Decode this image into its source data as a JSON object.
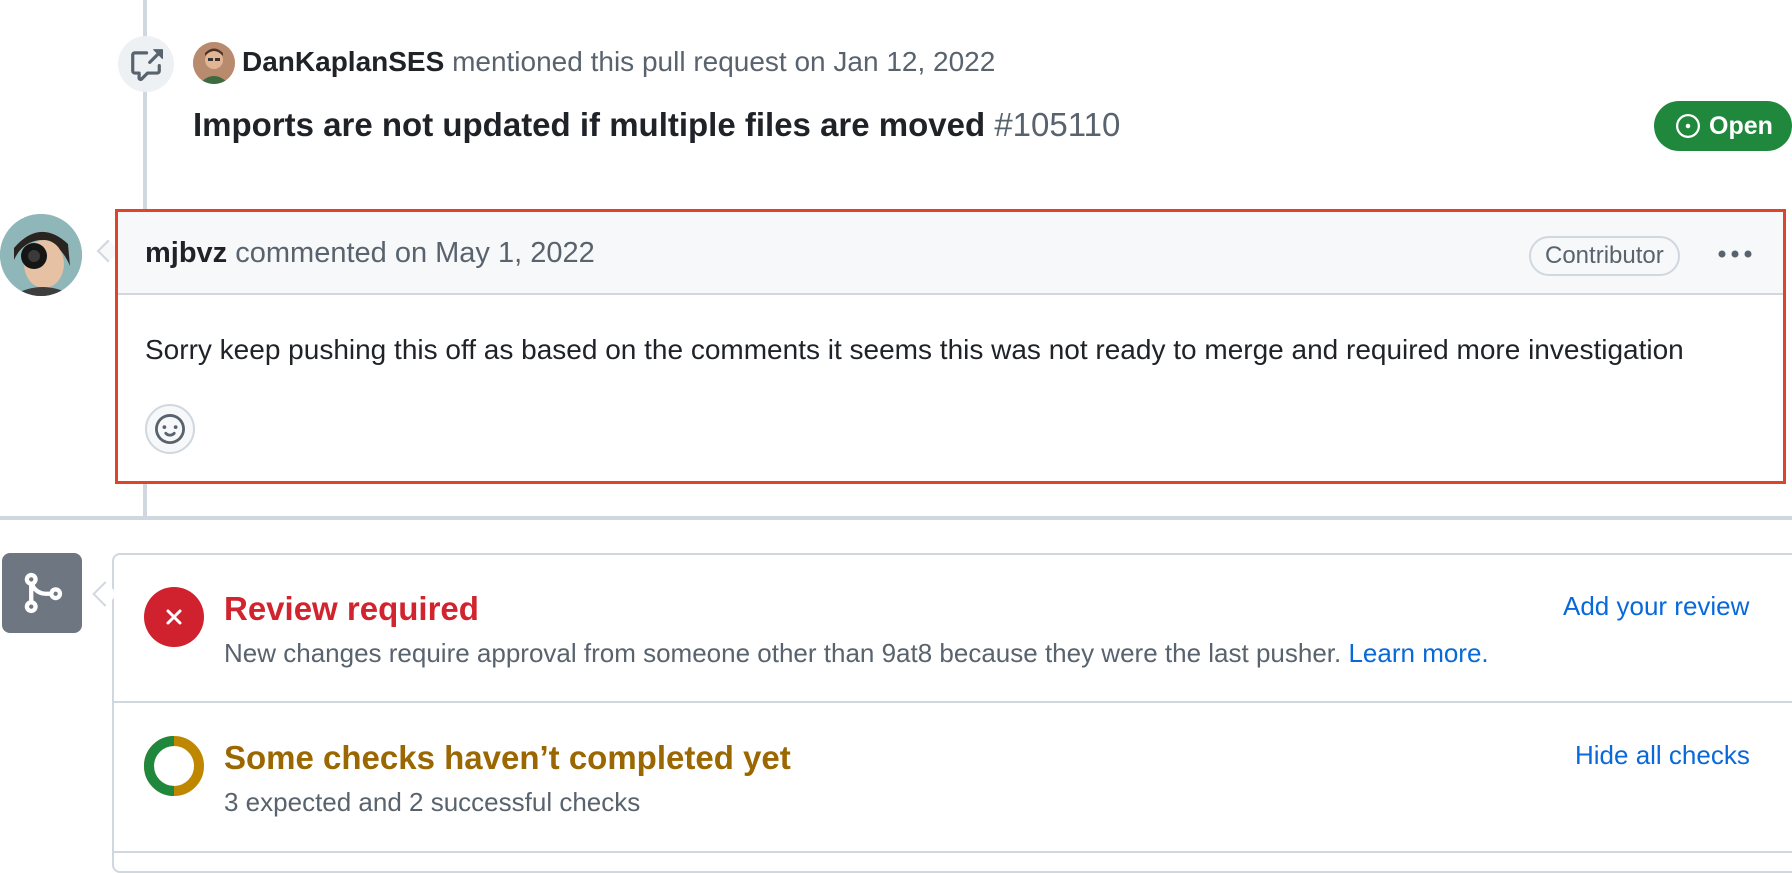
{
  "mention": {
    "author": "DanKaplanSES",
    "text": "mentioned this pull request on Jan 12, 2022",
    "title": "Imports are not updated if multiple files are moved",
    "number": "#105110",
    "status": "Open"
  },
  "comment": {
    "author": "mjbvz",
    "meta": "commented on May 1, 2022",
    "badge": "Contributor",
    "body": "Sorry keep pushing this off as based on the comments it seems this was not ready to merge and required more investigation"
  },
  "merge_box": {
    "review": {
      "title": "Review required",
      "description": "New changes require approval from someone other than 9at8 because they were the last pusher.",
      "learn_more": "Learn more.",
      "action": "Add your review"
    },
    "checks": {
      "title": "Some checks haven’t completed yet",
      "description": "3 expected and 2 successful checks",
      "action": "Hide all checks",
      "expected": 3,
      "successful": 2
    }
  },
  "colors": {
    "open_green": "#1f883d",
    "error_red": "#cf222e",
    "pending_yellow": "#bf8700",
    "link_blue": "#0969da",
    "highlight_border": "#e0432b"
  },
  "icons": [
    "cross-reference-icon",
    "avatar",
    "issue-open-icon",
    "kebab-horizontal-icon",
    "smiley-icon",
    "git-merge-icon",
    "x-icon",
    "checks-pending-ring-icon"
  ]
}
